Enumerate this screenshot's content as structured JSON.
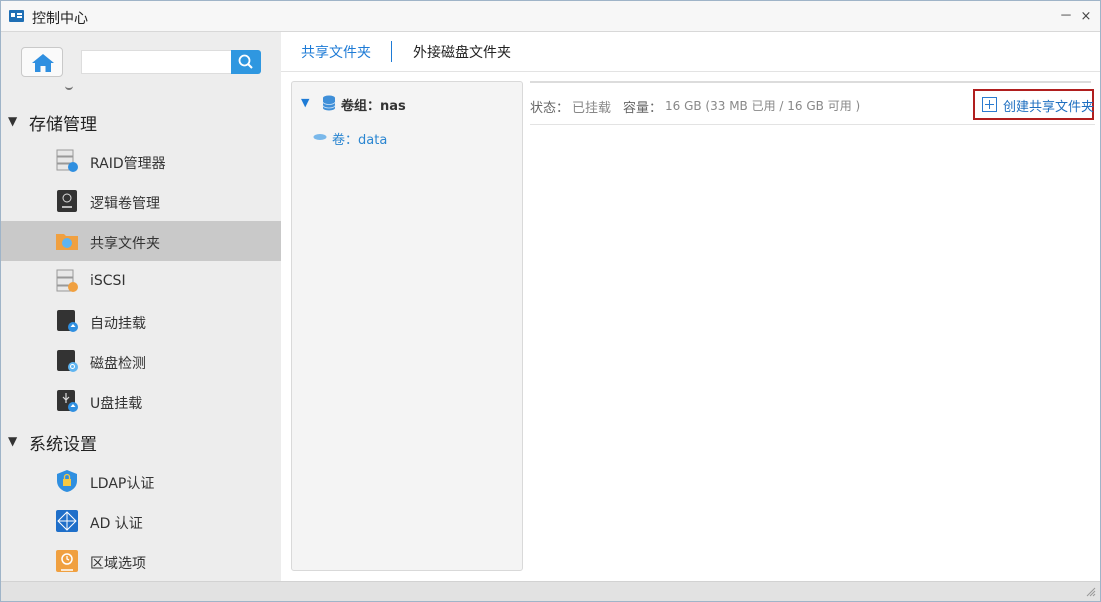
{
  "window": {
    "title": "控制中心",
    "minimize": "－",
    "close": "×"
  },
  "sidebar": {
    "search_placeholder": "",
    "groups": [
      {
        "label": "存储管理",
        "items": [
          {
            "label": "RAID管理器",
            "icon": "raid-server-icon"
          },
          {
            "label": "逻辑卷管理",
            "icon": "lvm-icon"
          },
          {
            "label": "共享文件夹",
            "icon": "shared-folder-icon",
            "active": true
          },
          {
            "label": "iSCSI",
            "icon": "iscsi-icon"
          },
          {
            "label": "自动挂载",
            "icon": "auto-mount-icon"
          },
          {
            "label": "磁盘检测",
            "icon": "disk-check-icon"
          },
          {
            "label": "U盘挂载",
            "icon": "usb-mount-icon"
          }
        ]
      },
      {
        "label": "系统设置",
        "items": [
          {
            "label": "LDAP认证",
            "icon": "ldap-lock-icon"
          },
          {
            "label": "AD 认证",
            "icon": "ad-network-icon"
          },
          {
            "label": "区域选项",
            "icon": "region-clock-icon"
          }
        ]
      }
    ]
  },
  "tabs": {
    "shared": "共享文件夹",
    "external": "外接磁盘文件夹"
  },
  "tree": {
    "group_label": "卷组：nas",
    "volume_label": "卷：data"
  },
  "info": {
    "status_label": "状态：",
    "status_value": "已挂载",
    "capacity_label": "容量：",
    "capacity_value": "16 GB (33 MB 已用 / 16 GB 可用 )"
  },
  "actions": {
    "create_shared": "创建共享文件夹"
  },
  "colors": {
    "accent": "#1e7bd6",
    "highlight_border": "#b01e1e",
    "sidebar_active": "#c9c9c9"
  }
}
